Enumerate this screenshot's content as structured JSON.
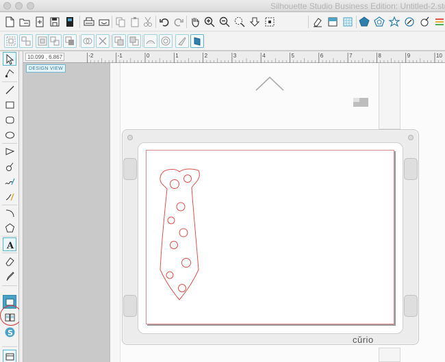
{
  "window": {
    "title": "Silhouette Studio Business Edition: Untitled-2.stu"
  },
  "toolbar_top": {
    "items": [
      "new-document-icon",
      "open-folder-icon",
      "open-library-icon",
      "save-icon",
      "save-to-library-icon",
      "print-icon",
      "send-to-printer-icon",
      "copy-icon",
      "paste-icon",
      "cut-scissors-icon",
      "undo-icon",
      "redo-icon",
      "pan-hand-icon",
      "zoom-in-icon",
      "zoom-out-icon",
      "zoom-select-icon",
      "pan-down-icon",
      "fit-to-page-icon",
      "eraser-panel-icon",
      "fill-panel-icon",
      "pattern-panel-icon",
      "pentagon-shape-icon",
      "rounded-pentagon-icon",
      "star-icon",
      "magic-wand-icon",
      "brush-icon",
      "lines-panel-icon"
    ]
  },
  "toolbar_secondary": {
    "items": [
      "group-icon",
      "ungroup-icon",
      "compound-path-icon",
      "release-compound-icon",
      "arrange-front-icon",
      "weld-icon",
      "delete-icon",
      "bring-forward-icon",
      "send-backward-icon",
      "trace-icon",
      "offset-icon",
      "knife-icon",
      "replicate-icon"
    ]
  },
  "left_tools": [
    "select-arrow-icon",
    "edit-points-icon",
    "line-tool-icon",
    "rectangle-tool-icon",
    "rounded-rectangle-tool-icon",
    "ellipse-tool-icon",
    "polygon-tool-icon",
    "curve-tool-icon",
    "freehand-tool-icon",
    "smooth-freehand-icon",
    "arc-tool-icon",
    "regular-polygon-icon",
    "text-tool-icon",
    "eraser-tool-icon",
    "knife-tool-icon",
    "design-page-icon",
    "library-icon",
    "store-icon"
  ],
  "ruler": {
    "coordinates": "10.099 , 6.867",
    "ticks": [
      "-2",
      "-1",
      "0",
      "1",
      "2",
      "3",
      "4",
      "5",
      "6",
      "7",
      "8",
      "9",
      "10"
    ]
  },
  "workspace": {
    "view_label": "DESIGN VIEW",
    "brand": "cŭrio"
  },
  "colors": {
    "accent": "#4aa3c6",
    "cut_line": "#e0514a",
    "highlight": "#d43535"
  }
}
